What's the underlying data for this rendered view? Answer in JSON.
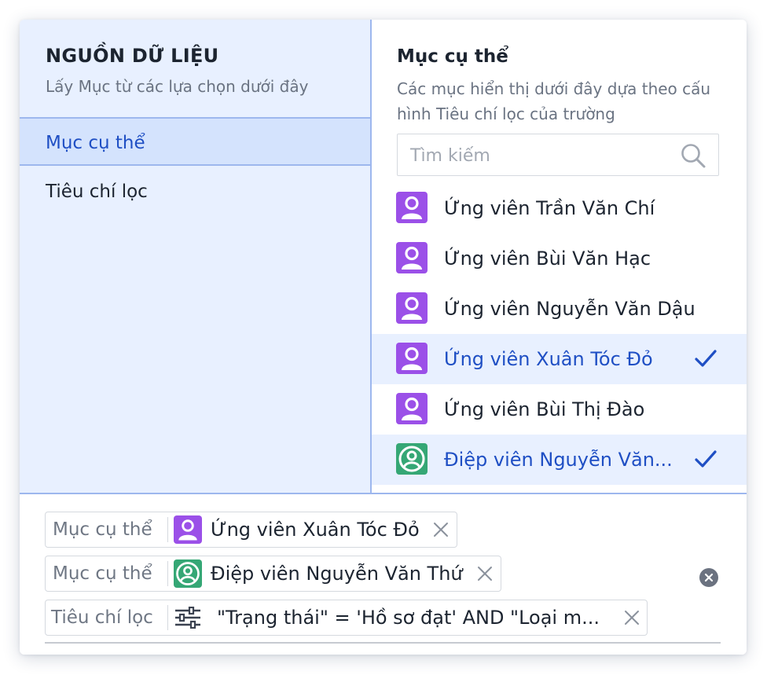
{
  "left_panel": {
    "title": "NGUỒN DỮ LIỆU",
    "subtitle": "Lấy Mục từ các lựa chọn dưới đây",
    "items": [
      {
        "label": "Mục cụ thể",
        "active": true
      },
      {
        "label": "Tiêu chí lọc",
        "active": false
      }
    ]
  },
  "right_panel": {
    "title": "Mục cụ thể",
    "subtitle": "Các mục hiển thị dưới đây dựa theo cấu hình Tiêu chí lọc của trường",
    "search_placeholder": "Tìm kiếm",
    "items": [
      {
        "name": "Ứng viên Trần Văn Chí",
        "avatar": "person-icon",
        "avatar_color": "#9b50e8",
        "selected": false
      },
      {
        "name": "Ứng viên Bùi Văn Hạc",
        "avatar": "person-icon",
        "avatar_color": "#9b50e8",
        "selected": false
      },
      {
        "name": "Ứng viên Nguyễn Văn Dậu",
        "avatar": "person-icon",
        "avatar_color": "#9b50e8",
        "selected": false
      },
      {
        "name": "Ứng viên Xuân Tóc Đỏ",
        "avatar": "person-icon",
        "avatar_color": "#9b50e8",
        "selected": true
      },
      {
        "name": "Ứng viên Bùi Thị Đào",
        "avatar": "person-icon",
        "avatar_color": "#9b50e8",
        "selected": false
      },
      {
        "name": "Điệp viên Nguyễn Văn...",
        "avatar": "person-circle-icon",
        "avatar_color": "#35a775",
        "selected": true
      }
    ]
  },
  "selected_chips": [
    {
      "label": "Mục cụ thể",
      "value": "Ứng viên Xuân Tóc Đỏ",
      "icon": "person-icon"
    },
    {
      "label": "Mục cụ thể",
      "value": "Điệp viên Nguyễn Văn Thứ",
      "icon": "person-circle-icon"
    },
    {
      "label": "Tiêu chí lọc",
      "value": "\"Trạng thái\" = 'Hồ sơ đạt' AND \"Loại m...",
      "icon": "filter-sliders-icon"
    }
  ],
  "colors": {
    "accent": "#1f4fc4",
    "left_bg": "#e8f0ff",
    "active_bg": "#d4e3fd",
    "divider": "#9db7ee",
    "purple_avatar": "#9b50e8",
    "green_avatar": "#35a775"
  }
}
